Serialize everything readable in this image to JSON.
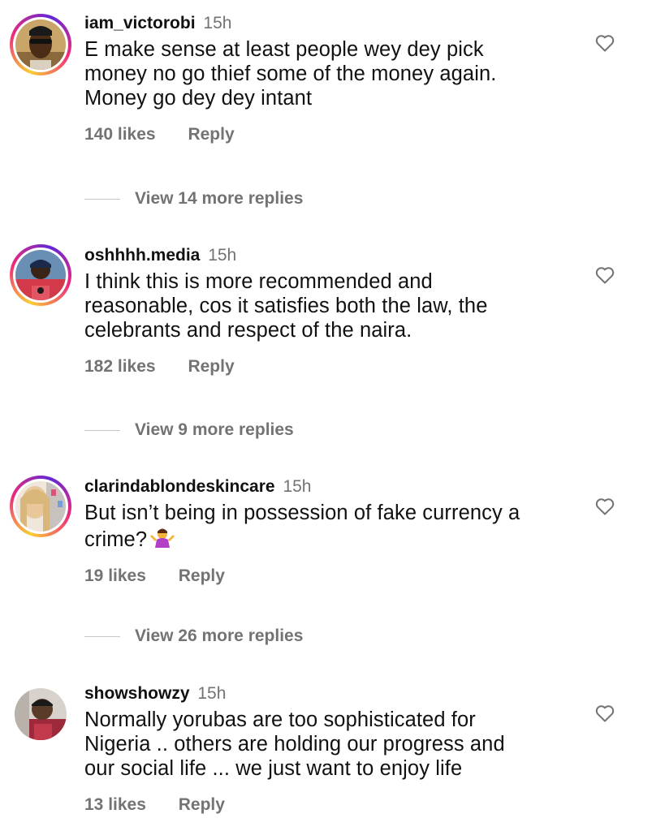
{
  "comments": [
    {
      "username": "iam_victorobi",
      "time": "15h",
      "text_lines": [
        "E make sense at least people wey dey pick",
        "money no go thief some of the money again.",
        "Money go dey dey intant"
      ],
      "likes": "140 likes",
      "reply": "Reply",
      "view_replies": "View 14 more replies"
    },
    {
      "username": "oshhhh.media",
      "time": "15h",
      "text_lines": [
        "I think this is more recommended and",
        "reasonable,  cos it satisfies both the law, the",
        "celebrants and respect of the naira."
      ],
      "likes": "182 likes",
      "reply": "Reply",
      "view_replies": "View 9 more replies"
    },
    {
      "username": "clarindablondeskincare",
      "time": "15h",
      "text_lines": [
        "But isn’t being in possession of fake currency a",
        "crime?"
      ],
      "likes": "19 likes",
      "reply": "Reply",
      "view_replies": "View 26 more replies"
    },
    {
      "username": "showshowzy",
      "time": "15h",
      "text_lines": [
        "Normally yorubas are too sophisticated for",
        "Nigeria .. others are holding our progress and",
        "our social life ... we just want to enjoy life"
      ],
      "likes": "13 likes",
      "reply": "Reply"
    }
  ],
  "icons": {
    "like": "heart-outline-icon",
    "emoji": "person-shrugging-emoji"
  },
  "colors": {
    "secondary_text": "#737373",
    "story_ring_start": "#f9ce34",
    "story_ring_mid": "#ee2a7b",
    "story_ring_end": "#6228d7"
  }
}
